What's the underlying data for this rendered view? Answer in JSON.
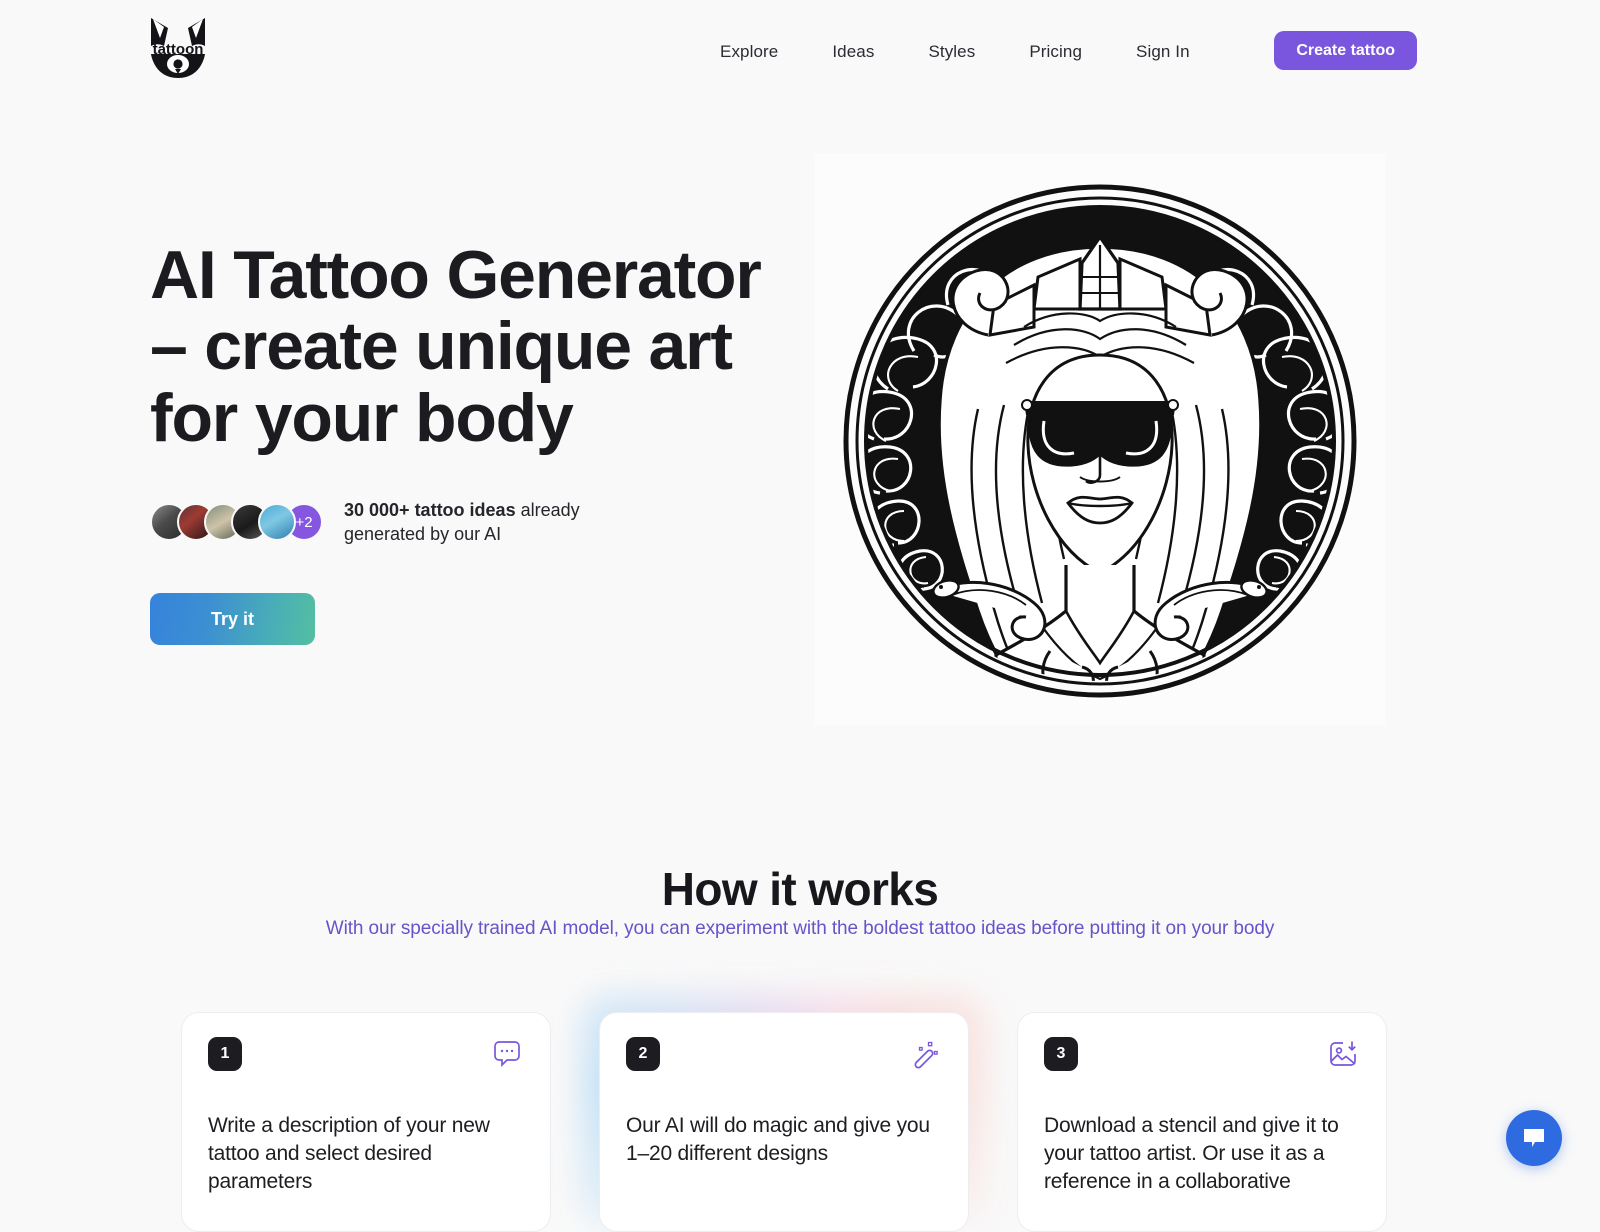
{
  "brand": {
    "name": "tattoon",
    "logo_icon": "fox-head-logo"
  },
  "nav": {
    "items": [
      {
        "label": "Explore"
      },
      {
        "label": "Ideas"
      },
      {
        "label": "Styles"
      },
      {
        "label": "Pricing"
      },
      {
        "label": "Sign In"
      }
    ],
    "cta_label": "Create tattoo",
    "cta_color": "#7A55DE"
  },
  "hero": {
    "title": "AI Tattoo Generator – create unique art for your body",
    "proof_strong": "30 000+ tattoo ideas",
    "proof_rest": " already generated by our AI",
    "avatars_overflow": "+2",
    "cta_label": "Try it",
    "cta_gradient_from": "#3583DC",
    "cta_gradient_to": "#54BFA0",
    "artwork_alt": "medusa-sunglasses-tattoo"
  },
  "how_it_works": {
    "title": "How it works",
    "subtitle": "With our specially trained AI model, you can experiment with the boldest tattoo ideas before putting it on your body",
    "subtitle_color": "#6A52C9",
    "cards": [
      {
        "number": "1",
        "text": "Write a description of your new tattoo and select desired parameters",
        "icon": "chat-bubble-dots-icon"
      },
      {
        "number": "2",
        "text": "Our AI will do magic and give you 1–20 different designs",
        "icon": "magic-wand-icon"
      },
      {
        "number": "3",
        "text": "Download a stencil and give it to your tattoo artist. Or use it as a reference in a collaborative",
        "icon": "image-download-icon"
      }
    ]
  },
  "chat_widget": {
    "icon": "chat-bubble-icon",
    "color": "#2F6BE0"
  }
}
